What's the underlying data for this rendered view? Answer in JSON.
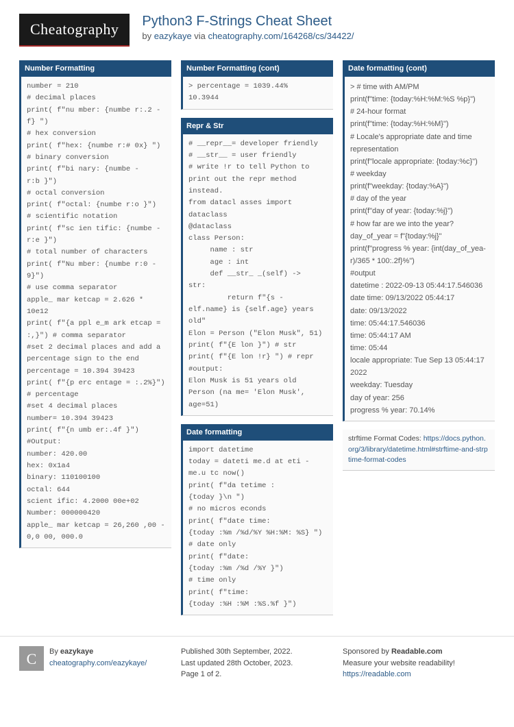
{
  "header": {
    "logo": "Cheatography",
    "title": "Python3 F-Strings Cheat Sheet",
    "by": "by ",
    "author": "eazykaye",
    "via": " via ",
    "url": "cheatography.com/164268/cs/34422/"
  },
  "col1": {
    "block1": {
      "title": "Number Formatting",
      "code": "number = 210\n# decimal places\nprint( f\"nu mber: {numbe r:.2 ­-\nf} \")\n# hex conversion\nprint( f\"hex: {numbe r:# 0x} \")\n# binary conversion\nprint( f\"bi nary: {numbe ­-\nr:b }\")\n# octal conversion\nprint( f\"octal: {numbe r:o }\")\n# scientific notation\nprint( f\"sc ien tific: {numbe ­-\nr:e }\")\n# total number of characters\nprint( f\"Nu mber: {numbe r:0 ­-\n9}\")\n# use comma separator\napple_ mar ketcap = 2.626 *\n10e12\nprint( f\"{a ppl e_m ark etcap =\n:,}\") # comma separator\n#set 2 decimal places and add a\npercentage sign to the end\npercentage = 10.394 39423\nprint( f\"{p erc entage = :.2%}\")\n# percentage\n#set 4 decimal places\nnumber= 10.394 39423\nprint( f\"{n umb er:.4f }\")\n#Output:\nnumber: 420.00\nhex: 0x1a4\nbinary: 110100100\noctal: 644\nscient ific: 4.2000 00e+02\nNumber: 000000420\napple_ mar ketcap = 26,260 ,00 ­-\n0,0 00, 000.0"
    }
  },
  "col2": {
    "block1": {
      "title": "Number Formatting (cont)",
      "code": "> percentage = 1039.44%\n10.3944"
    },
    "block2": {
      "title": "Repr & Str",
      "code": "# __repr__= developer friendly\n# __str__ = user friendly\n# write !r to tell Python to\nprint out the repr method\ninstead.\nfrom datacl asses import\ndataclass\n@dataclass\nclass Person:\n     name : str\n     age : int\n     def __str_ _(self) ->\nstr:\n         return f\"{s ­-\nelf.name} is {self.age} years\nold\"\nElon = Person (\"Elon Musk\", 51)\nprint( f\"{E lon }\") # str\nprint( f\"{E lon !r} \") # repr\n#output:\nElon Musk is 51 years old\nPerson (na me= 'Elon Musk',\nage=51)"
    },
    "block3": {
      "title": "Date formatting",
      "code": "import datetime\ntoday = dateti me.d at eti ­-\nme.u tc now()\nprint( f\"da tetime :\n{today }\\n \")\n# no micros econds\nprint( f\"date time:\n{today :%m /%d/%Y %H:%M: %S} \")\n# date only\nprint( f\"date:\n{today :%m /%d /%Y }\")\n# time only\nprint( f\"time:\n{today :%H :%M :%S.%f }\")"
    }
  },
  "col3": {
    "block1": {
      "title": "Date formatting (cont)",
      "text": "> # time with AM/PM\nprint(f\"time: {today:%H:%M:%S %p}\")\n# 24-hour format\nprint(f\"time: {today:%H:%M}\")\n# Locale's appropriate date and time repres­entation\nprint(f\"locale appropriate: {today:%c}\")\n# weekday\nprint(f\"weekday: {today:%A}\")\n# day of the year\nprint(f\"day of year: {today:%j}\")\n# how far are we into the year?\nday_of_year = f\"{today:%j}\"\nprint(f\"progress % year: {int(day_of_yea­r)/365 * 100:.2f}%\")\n#output\ndatetime : 2022-09-13 05:44:17.546036\ndate time: 09/13/2022 05:44:17\ndate: 09/13/2022\ntime: 05:44:17.546036\ntime: 05:44:17 AM\ntime: 05:44\nlocale appropriate: Tue Sep 13 05:44:17 2022\nweekday: Tuesday\nday of year: 256\nprogress % year: 70.14%"
    },
    "note": {
      "label": "strftime Format Codes: ",
      "link": "https://docs.pytho­n.org/3/library/datetime.html#strftime-and-strptime-format-codes"
    }
  },
  "footer": {
    "avatar": "C",
    "by": "By ",
    "author": "eazykaye",
    "authorurl": "cheatography.com/eazykaye/",
    "published": "Published 30th September, 2022.",
    "updated": "Last updated 28th October, 2023.",
    "page": "Page 1 of 2.",
    "sponsoredby": "Sponsored by ",
    "sponsor": "Readable.com",
    "tagline": "Measure your website readability!",
    "sponsorurl": "https://readable.com"
  }
}
